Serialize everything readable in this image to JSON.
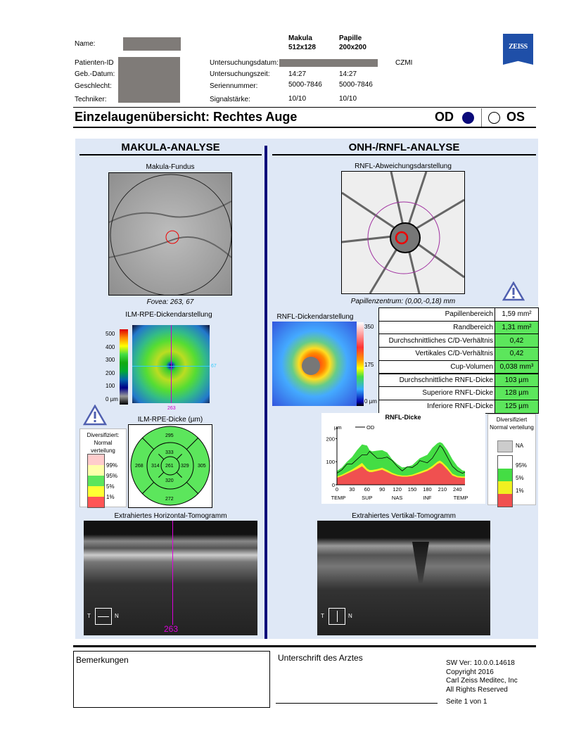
{
  "header": {
    "name_label": "Name:",
    "patient_id_label": "Patienten-ID",
    "dob_label": "Geb.-Datum:",
    "sex_label": "Geschlecht:",
    "technician_label": "Techniker:",
    "exam_date_label": "Untersuchungsdatum:",
    "exam_time_label": "Untersuchungszeit:",
    "serial_label": "Seriennummer:",
    "signal_label": "Signalstärke:",
    "makula_title": "Makula",
    "makula_scan": "512x128",
    "papille_title": "Papille",
    "papille_scan": "200x200",
    "makula_time": "14:27",
    "papille_time": "14:27",
    "makula_serial": "5000-7846",
    "papille_serial": "5000-7846",
    "makula_signal": "10/10",
    "papille_signal": "10/10",
    "institution": "CZMI",
    "logo_text": "ZEISS"
  },
  "title": {
    "text": "Einzelaugenübersicht: Rechtes Auge",
    "od": "OD",
    "os": "OS",
    "selected": "OD",
    "accent": "#0a0a7a"
  },
  "makula": {
    "heading": "MAKULA-ANALYSE",
    "fundus_title": "Makula-Fundus",
    "fovea": "Fovea: 263, 67",
    "thickness_map_title": "ILM-RPE-Dickendarstellung",
    "colorbar_ticks": [
      "500",
      "400",
      "300",
      "200",
      "100",
      "0 µm"
    ],
    "cursor_x": "263",
    "cursor_y": "67",
    "grid_title": "ILM-RPE-Dicke (µm)",
    "grid": {
      "center": "261",
      "inner_superior": "333",
      "inner_nasal": "329",
      "inner_inferior": "320",
      "inner_temporal": "314",
      "outer_superior": "295",
      "outer_nasal": "305",
      "outer_inferior": "272",
      "outer_temporal": "268"
    },
    "legend": {
      "title": "Diversifiziert: Normal verteilung",
      "levels": [
        "99%",
        "95%",
        "5%",
        "1%"
      ]
    },
    "tomogram_title": "Extrahiertes Horizontal-Tomogramm",
    "tomogram_t": "T",
    "tomogram_n": "N",
    "tomogram_pos": "263"
  },
  "onh": {
    "heading": "ONH-/RNFL-ANALYSE",
    "deviation_title": "RNFL-Abweichungsdarstellung",
    "disc_center": "Papillenzentrum: (0,00,-0,18) mm",
    "thickness_title": "RNFL-Dickendarstellung",
    "colorbar_ticks": [
      "350",
      "175",
      "0 µm"
    ],
    "table": [
      {
        "label": "Papillenbereich",
        "value": "1,59 mm²",
        "status": "white"
      },
      {
        "label": "Randbereich",
        "value": "1,31 mm²",
        "status": "green"
      },
      {
        "label": "Durchschnittliches C/D-Verhältnis",
        "value": "0,42",
        "status": "green"
      },
      {
        "label": "Vertikales C/D-Verhältnis",
        "value": "0,42",
        "status": "green"
      },
      {
        "label": "Cup-Volumen",
        "value": "0,038 mm³",
        "status": "green"
      },
      {
        "label": "Durchschnittliche RNFL-Dicke",
        "value": "103 µm",
        "status": "green"
      },
      {
        "label": "Superiore RNFL-Dicke",
        "value": "128 µm",
        "status": "green"
      },
      {
        "label": "Inferiore RNFL-Dicke",
        "value": "125 µm",
        "status": "green"
      }
    ],
    "legend": {
      "title": "Diversifiziert Normal verteilung",
      "levels": [
        "NA",
        "95%",
        "5%",
        "1%"
      ]
    },
    "tomogram_title": "Extrahiertes Vertikal-Tomogramm",
    "tomogram_t": "T",
    "tomogram_n": "N"
  },
  "chart_data": {
    "type": "area",
    "title": "RNFL-Dicke",
    "ylabel": "µm",
    "legend": [
      "OD"
    ],
    "legend_placement": "top-left",
    "xlim": [
      0,
      255
    ],
    "ylim": [
      0,
      250
    ],
    "xticks": [
      0,
      30,
      60,
      90,
      120,
      150,
      180,
      210,
      240
    ],
    "yticks": [
      0,
      100,
      200
    ],
    "sector_labels": [
      "TEMP",
      "SUP",
      "NAS",
      "INF",
      "TEMP"
    ],
    "x": [
      0,
      10,
      20,
      30,
      40,
      50,
      60,
      65,
      70,
      80,
      90,
      100,
      110,
      120,
      130,
      140,
      150,
      160,
      165,
      180,
      190,
      200,
      205,
      210,
      220,
      230,
      240,
      250,
      255
    ],
    "series": [
      {
        "name": "OD",
        "values": [
          50,
          65,
          90,
          90,
          110,
          130,
          130,
          145,
          135,
          115,
          115,
          120,
          105,
          80,
          60,
          78,
          75,
          90,
          105,
          95,
          115,
          150,
          170,
          160,
          120,
          80,
          60,
          50,
          55
        ]
      },
      {
        "name": "1%",
        "values": [
          30,
          38,
          48,
          58,
          68,
          80,
          60,
          55,
          55,
          60,
          65,
          55,
          45,
          38,
          35,
          35,
          38,
          45,
          48,
          60,
          72,
          90,
          95,
          88,
          65,
          40,
          32,
          30,
          30
        ]
      },
      {
        "name": "5%",
        "values": [
          36,
          44,
          55,
          66,
          80,
          95,
          70,
          64,
          64,
          68,
          74,
          64,
          52,
          44,
          40,
          40,
          44,
          52,
          56,
          68,
          82,
          100,
          105,
          98,
          76,
          48,
          38,
          36,
          36
        ]
      },
      {
        "name": "95%",
        "values": [
          60,
          75,
          100,
          120,
          150,
          175,
          170,
          150,
          145,
          148,
          150,
          140,
          110,
          90,
          75,
          78,
          85,
          105,
          115,
          130,
          160,
          180,
          185,
          180,
          150,
          110,
          80,
          62,
          60
        ]
      }
    ],
    "colors": {
      "od": "#000000",
      "below1": "#f05050",
      "below5": "#f0f020",
      "normal": "#44dd44",
      "above95": "#ffffff"
    }
  }
}
